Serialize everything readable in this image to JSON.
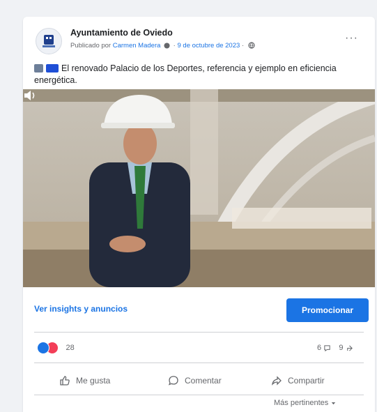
{
  "post": {
    "page_name": "Ayuntamiento de Oviedo",
    "published_prefix": "Publicado por",
    "author": "Carmen Madera",
    "date": "9 de octubre de 2023",
    "more_label": "···",
    "caption_text": "El renovado Palacio de los Deportes, referencia y ejemplo en eficiencia energética.",
    "caption_icons": [
      "video-icon",
      "flag-icon"
    ]
  },
  "video": {
    "progress": 0.0,
    "volume_icon": "volume-icon"
  },
  "bar": {
    "insights_label": "Ver insights y anuncios",
    "promote_label": "Promocionar"
  },
  "reactions": {
    "count": "28",
    "comments_count": "6",
    "shares_count": "9"
  },
  "actions": {
    "like_label": "Me gusta",
    "comment_label": "Comentar",
    "share_label": "Compartir"
  },
  "sort": {
    "label": "Más pertinentes"
  },
  "colors": {
    "accent": "#1b74e4",
    "like": "#1b74e4",
    "love": "#f33e58",
    "muted": "#65676b"
  }
}
